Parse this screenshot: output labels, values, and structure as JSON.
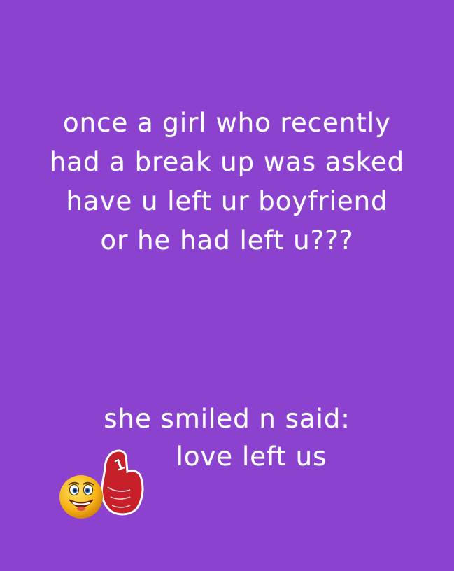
{
  "story": {
    "lines": [
      "once a girl who recently",
      "had a break up was asked",
      "have u left ur boyfriend",
      "or he had left u???"
    ]
  },
  "reply": {
    "lines": [
      "she smiled n said:",
      "love left us"
    ]
  },
  "stickers": {
    "face_icon": "laughing-face-icon",
    "finger_icon": "number-one-foam-finger-icon",
    "finger_number": "1"
  },
  "colors": {
    "background": "#8a42cf",
    "text": "#ffffff",
    "finger": "#c8202a",
    "face": "#f6b318"
  }
}
